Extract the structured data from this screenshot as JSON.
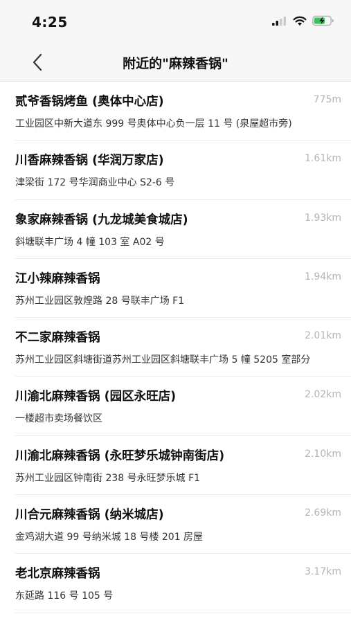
{
  "status": {
    "time": "4:25"
  },
  "nav": {
    "title": "附近的\"麻辣香锅\""
  },
  "results": [
    {
      "name": "贰爷香锅烤鱼 (奥体中心店)",
      "distance": "775m",
      "address": "工业园区中新大道东 999 号奥体中心负一层 11 号 (泉屋超市旁)"
    },
    {
      "name": "川香麻辣香锅 (华润万家店)",
      "distance": "1.61km",
      "address": "津梁街 172 号华润商业中心 S2-6 号"
    },
    {
      "name": "象家麻辣香锅 (九龙城美食城店)",
      "distance": "1.93km",
      "address": "斜塘联丰广场 4 幢 103 室 A02 号"
    },
    {
      "name": "江小辣麻辣香锅",
      "distance": "1.94km",
      "address": "苏州工业园区敦煌路 28 号联丰广场 F1"
    },
    {
      "name": "不二家麻辣香锅",
      "distance": "2.01km",
      "address": "苏州工业园区斜塘街道苏州工业园区斜塘联丰广场 5 幢 5205 室部分"
    },
    {
      "name": "川渝北麻辣香锅 (园区永旺店)",
      "distance": "2.02km",
      "address": "一楼超市卖场餐饮区"
    },
    {
      "name": "川渝北麻辣香锅 (永旺梦乐城钟南街店)",
      "distance": "2.10km",
      "address": "苏州工业园区钟南街 238 号永旺梦乐城 F1"
    },
    {
      "name": "川合元麻辣香锅 (纳米城店)",
      "distance": "2.69km",
      "address": "金鸡湖大道 99 号纳米城 18 号楼 201 房屋"
    },
    {
      "name": "老北京麻辣香锅",
      "distance": "3.17km",
      "address": "东延路 116 号 105 号"
    }
  ]
}
